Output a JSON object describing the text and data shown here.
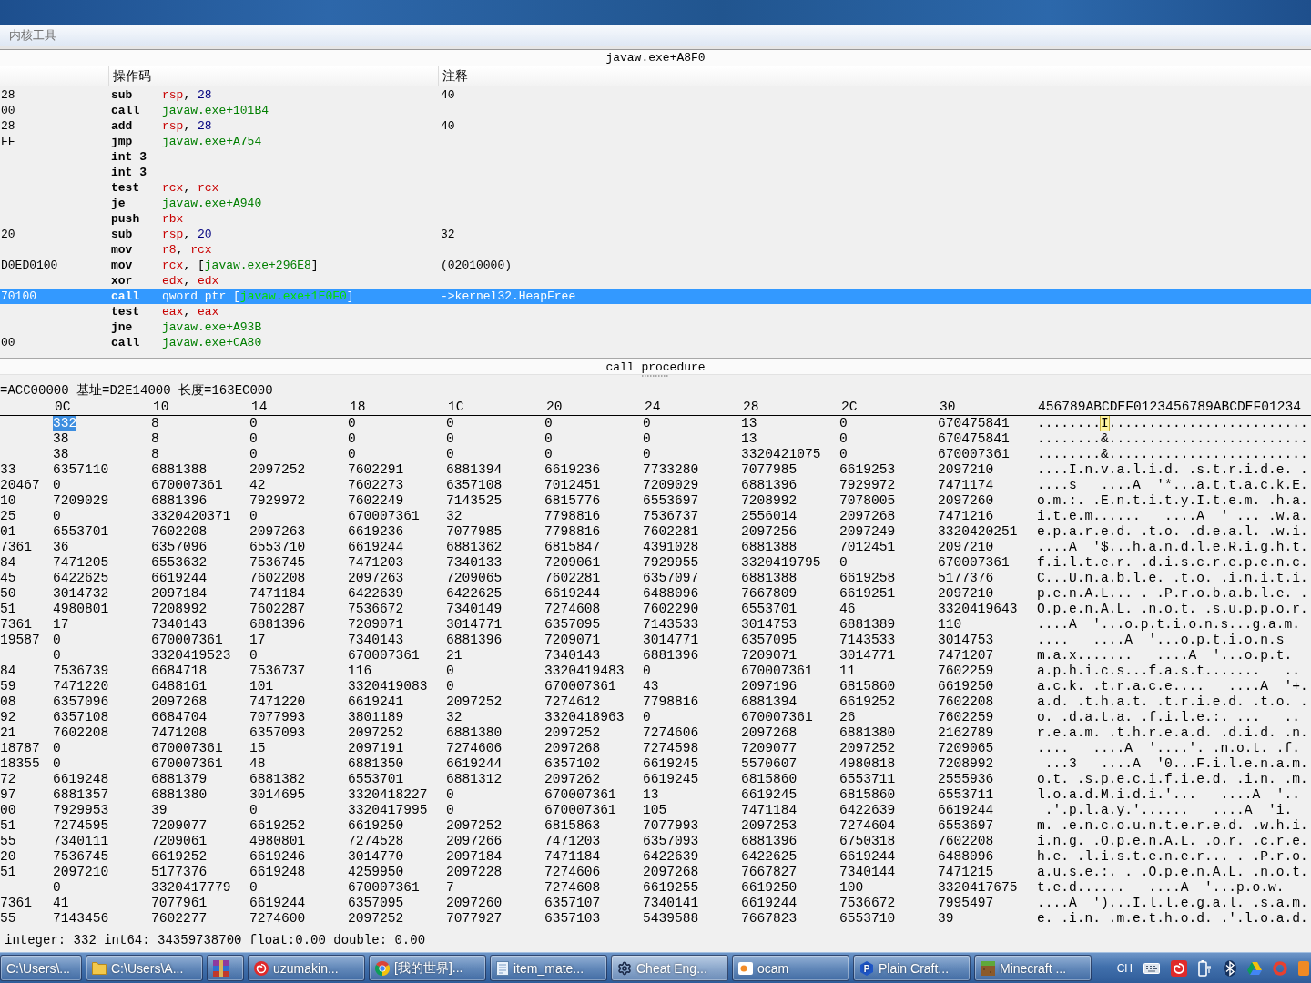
{
  "menu": [
    {
      "label": "内核工具"
    }
  ],
  "disassembly": {
    "address": "javaw.exe+A8F0",
    "columns": [
      "操作码",
      "注释"
    ],
    "rows": [
      {
        "bytes": "28",
        "mnemonic": "sub",
        "operands": [
          {
            "text": "rsp",
            "kind": "register"
          },
          {
            "text": ", ",
            "kind": "plain"
          },
          {
            "text": "28",
            "kind": "number"
          }
        ],
        "comment": "40",
        "selected": false
      },
      {
        "bytes": "00",
        "mnemonic": "call",
        "operands": [
          {
            "text": "javaw.exe+101B4",
            "kind": "symbol"
          }
        ],
        "selected": false
      },
      {
        "bytes": "28",
        "mnemonic": "add",
        "operands": [
          {
            "text": "rsp",
            "kind": "register"
          },
          {
            "text": ", ",
            "kind": "plain"
          },
          {
            "text": "28",
            "kind": "number"
          }
        ],
        "comment": "40",
        "selected": false
      },
      {
        "bytes": "FF",
        "mnemonic": "jmp",
        "operands": [
          {
            "text": "javaw.exe+A754",
            "kind": "symbol"
          }
        ],
        "selected": false
      },
      {
        "mnemonic": "int 3",
        "selected": false
      },
      {
        "mnemonic": "int 3",
        "selected": false
      },
      {
        "mnemonic": "test",
        "operands": [
          {
            "text": "rcx",
            "kind": "register"
          },
          {
            "text": ", ",
            "kind": "plain"
          },
          {
            "text": "rcx",
            "kind": "register"
          }
        ],
        "selected": false
      },
      {
        "mnemonic": "je",
        "operands": [
          {
            "text": "javaw.exe+A940",
            "kind": "symbol"
          }
        ],
        "selected": false
      },
      {
        "mnemonic": "push",
        "operands": [
          {
            "text": "rbx",
            "kind": "register"
          }
        ],
        "selected": false
      },
      {
        "bytes": "20",
        "mnemonic": "sub",
        "operands": [
          {
            "text": "rsp",
            "kind": "register"
          },
          {
            "text": ", ",
            "kind": "plain"
          },
          {
            "text": "20",
            "kind": "number"
          }
        ],
        "comment": "32",
        "selected": false
      },
      {
        "mnemonic": "mov",
        "operands": [
          {
            "text": "r8",
            "kind": "register"
          },
          {
            "text": ", ",
            "kind": "plain"
          },
          {
            "text": "rcx",
            "kind": "register"
          }
        ],
        "selected": false
      },
      {
        "bytes": "D0ED0100",
        "mnemonic": "mov",
        "operands": [
          {
            "text": "rcx",
            "kind": "register"
          },
          {
            "text": ", [",
            "kind": "plain"
          },
          {
            "text": "javaw.exe+296E8",
            "kind": "symbol"
          },
          {
            "text": "]",
            "kind": "plain"
          }
        ],
        "comment": "(02010000)",
        "selected": false
      },
      {
        "mnemonic": "xor",
        "operands": [
          {
            "text": "edx",
            "kind": "register"
          },
          {
            "text": ", ",
            "kind": "plain"
          },
          {
            "text": "edx",
            "kind": "register"
          }
        ],
        "selected": false
      },
      {
        "bytes": "70100",
        "mnemonic": "call",
        "operands": [
          {
            "text": "qword ptr [",
            "kind": "plain"
          },
          {
            "text": "javaw.exe+1E0F0",
            "kind": "symbol"
          },
          {
            "text": "]",
            "kind": "plain"
          }
        ],
        "comment": "->kernel32.HeapFree",
        "selected": true
      },
      {
        "mnemonic": "test",
        "operands": [
          {
            "text": "eax",
            "kind": "register"
          },
          {
            "text": ", ",
            "kind": "plain"
          },
          {
            "text": "eax",
            "kind": "register"
          }
        ],
        "selected": false
      },
      {
        "mnemonic": "jne",
        "operands": [
          {
            "text": "javaw.exe+A93B",
            "kind": "symbol"
          }
        ],
        "selected": false
      },
      {
        "bytes": "00",
        "mnemonic": "call",
        "operands": [
          {
            "text": "javaw.exe+CA80",
            "kind": "symbol"
          }
        ],
        "selected": false
      }
    ]
  },
  "procedure_label": "call procedure",
  "memory_view": {
    "region": "=ACC00000 基址=D2E14000 长度=163EC000",
    "columns": [
      "0C",
      "10",
      "14",
      "18",
      "1C",
      "20",
      "24",
      "28",
      "2C",
      "30"
    ],
    "ascii_header": "456789ABCDEF0123456789ABCDEF01234",
    "rows": [
      {
        "values": [
          "332",
          "8",
          "0",
          "0",
          "0",
          "0",
          "0",
          "13",
          "0",
          "670475841"
        ],
        "ascii": [
          {
            "text": "........",
            "cursor": false
          },
          {
            "text": "I",
            "cursor": true
          },
          {
            "text": ".........................",
            "cursor": false
          }
        ],
        "selected": true
      },
      {
        "values": [
          "38",
          "8",
          "0",
          "0",
          "0",
          "0",
          "0",
          "13",
          "0",
          "670475841"
        ],
        "ascii": [
          {
            "text": "........&.........................",
            "cursor": false
          }
        ],
        "selected": false
      },
      {
        "values": [
          "38",
          "8",
          "0",
          "0",
          "0",
          "0",
          "0",
          "3320421075",
          "0",
          "670007361"
        ],
        "ascii": [
          {
            "text": "........&.........................",
            "cursor": false
          }
        ],
        "selected": false
      },
      {
        "address": "33",
        "values": [
          "6357110",
          "6881388",
          "2097252",
          "7602291",
          "6881394",
          "6619236",
          "7733280",
          "7077985",
          "6619253",
          "2097210"
        ],
        "ascii": [
          {
            "text": "....I.n.v.a.l.i.d. .s.t.r.i.d.e. .",
            "cursor": false
          }
        ],
        "selected": false
      },
      {
        "address": "20467",
        "values": [
          "0",
          "670007361",
          "42",
          "7602273",
          "6357108",
          "7012451",
          "7209029",
          "6881396",
          "7929972",
          "7471174"
        ],
        "ascii": [
          {
            "text": "....s   ....A  '*...a.t.t.a.c.k.E.",
            "cursor": false
          }
        ],
        "selected": false
      },
      {
        "address": "10",
        "values": [
          "7209029",
          "6881396",
          "7929972",
          "7602249",
          "7143525",
          "6815776",
          "6553697",
          "7208992",
          "7078005",
          "2097260"
        ],
        "ascii": [
          {
            "text": "o.m.:. .E.n.t.i.t.y.I.t.e.m. .h.a.",
            "cursor": false
          }
        ],
        "selected": false
      },
      {
        "address": "25",
        "values": [
          "0",
          "3320420371",
          "0",
          "670007361",
          "32",
          "7798816",
          "7536737",
          "2556014",
          "2097268",
          "7471216"
        ],
        "ascii": [
          {
            "text": "i.t.e.m......   ....A  ' ... .w.a.",
            "cursor": false
          }
        ],
        "selected": false
      },
      {
        "address": "01",
        "values": [
          "6553701",
          "7602208",
          "2097263",
          "6619236",
          "7077985",
          "7798816",
          "7602281",
          "2097256",
          "2097249",
          "3320420251"
        ],
        "ascii": [
          {
            "text": "e.p.a.r.e.d. .t.o. .d.e.a.l. .w.i.",
            "cursor": false
          }
        ],
        "selected": false
      },
      {
        "address": "7361",
        "values": [
          "36",
          "6357096",
          "6553710",
          "6619244",
          "6881362",
          "6815847",
          "4391028",
          "6881388",
          "7012451",
          "2097210"
        ],
        "ascii": [
          {
            "text": "....A  '$...h.a.n.d.l.e.R.i.g.h.t.",
            "cursor": false
          }
        ],
        "selected": false
      },
      {
        "address": "84",
        "values": [
          "7471205",
          "6553632",
          "7536745",
          "7471203",
          "7340133",
          "7209061",
          "7929955",
          "3320419795",
          "0",
          "670007361"
        ],
        "ascii": [
          {
            "text": "f.i.l.t.e.r. .d.i.s.c.r.e.p.e.n.c.",
            "cursor": false
          }
        ],
        "selected": false
      },
      {
        "address": "45",
        "values": [
          "6422625",
          "6619244",
          "7602208",
          "2097263",
          "7209065",
          "7602281",
          "6357097",
          "6881388",
          "6619258",
          "5177376"
        ],
        "ascii": [
          {
            "text": "C...U.n.a.b.l.e. .t.o. .i.n.i.t.i.",
            "cursor": false
          }
        ],
        "selected": false
      },
      {
        "address": "50",
        "values": [
          "3014732",
          "2097184",
          "7471184",
          "6422639",
          "6422625",
          "6619244",
          "6488096",
          "7667809",
          "6619251",
          "2097210"
        ],
        "ascii": [
          {
            "text": "p.e.n.A.L... . .P.r.o.b.a.b.l.e. .",
            "cursor": false
          }
        ],
        "selected": false
      },
      {
        "address": "51",
        "values": [
          "4980801",
          "7208992",
          "7602287",
          "7536672",
          "7340149",
          "7274608",
          "7602290",
          "6553701",
          "46",
          "3320419643"
        ],
        "ascii": [
          {
            "text": "O.p.e.n.A.L. .n.o.t. .s.u.p.p.o.r.",
            "cursor": false
          }
        ],
        "selected": false
      },
      {
        "address": "7361",
        "values": [
          "17",
          "7340143",
          "6881396",
          "7209071",
          "3014771",
          "6357095",
          "7143533",
          "3014753",
          "6881389",
          "110"
        ],
        "ascii": [
          {
            "text": "....A  '...o.p.t.i.o.n.s...g.a.m.",
            "cursor": false
          }
        ],
        "selected": false
      },
      {
        "address": "19587",
        "values": [
          "0",
          "670007361",
          "17",
          "7340143",
          "6881396",
          "7209071",
          "3014771",
          "6357095",
          "7143533",
          "3014753"
        ],
        "ascii": [
          {
            "text": "....   ....A  '...o.p.t.i.o.n.s",
            "cursor": false
          }
        ],
        "selected": false
      },
      {
        "values": [
          "0",
          "3320419523",
          "0",
          "670007361",
          "21",
          "7340143",
          "6881396",
          "7209071",
          "3014771",
          "7471207"
        ],
        "ascii": [
          {
            "text": "m.a.x.......   ....A  '...o.p.t.",
            "cursor": false
          }
        ],
        "selected": false
      },
      {
        "address": "84",
        "values": [
          "7536739",
          "6684718",
          "7536737",
          "116",
          "0",
          "3320419483",
          "0",
          "670007361",
          "11",
          "7602259"
        ],
        "ascii": [
          {
            "text": "a.p.h.i.c.s...f.a.s.t.......   ..",
            "cursor": false
          }
        ],
        "selected": false
      },
      {
        "address": "59",
        "values": [
          "7471220",
          "6488161",
          "101",
          "3320419083",
          "0",
          "670007361",
          "43",
          "2097196",
          "6815860",
          "6619250"
        ],
        "ascii": [
          {
            "text": "a.c.k. .t.r.a.c.e....   ....A  '+.",
            "cursor": false
          }
        ],
        "selected": false
      },
      {
        "address": "08",
        "values": [
          "6357096",
          "2097268",
          "7471220",
          "6619241",
          "2097252",
          "7274612",
          "7798816",
          "6881394",
          "6619252",
          "7602208"
        ],
        "ascii": [
          {
            "text": "a.d. .t.h.a.t. .t.r.i.e.d. .t.o. .",
            "cursor": false
          }
        ],
        "selected": false
      },
      {
        "address": "92",
        "values": [
          "6357108",
          "6684704",
          "7077993",
          "3801189",
          "32",
          "3320418963",
          "0",
          "670007361",
          "26",
          "7602259"
        ],
        "ascii": [
          {
            "text": "o. .d.a.t.a. .f.i.l.e.:. ...   ..",
            "cursor": false
          }
        ],
        "selected": false
      },
      {
        "address": "21",
        "values": [
          "7602208",
          "7471208",
          "6357093",
          "2097252",
          "6881380",
          "2097252",
          "7274606",
          "2097268",
          "6881380",
          "2162789"
        ],
        "ascii": [
          {
            "text": "r.e.a.m. .t.h.r.e.a.d. .d.i.d. .n.",
            "cursor": false
          }
        ],
        "selected": false
      },
      {
        "address": "18787",
        "values": [
          "0",
          "670007361",
          "15",
          "2097191",
          "7274606",
          "2097268",
          "7274598",
          "7209077",
          "2097252",
          "7209065"
        ],
        "ascii": [
          {
            "text": "....   ....A  '....'. .n.o.t. .f.",
            "cursor": false
          }
        ],
        "selected": false
      },
      {
        "address": "18355",
        "values": [
          "0",
          "670007361",
          "48",
          "6881350",
          "6619244",
          "6357102",
          "6619245",
          "5570607",
          "4980818",
          "7208992"
        ],
        "ascii": [
          {
            "text": " ...3   ....A  '0...F.i.l.e.n.a.m.",
            "cursor": false
          }
        ],
        "selected": false
      },
      {
        "address": "72",
        "values": [
          "6619248",
          "6881379",
          "6881382",
          "6553701",
          "6881312",
          "2097262",
          "6619245",
          "6815860",
          "6553711",
          "2555936"
        ],
        "ascii": [
          {
            "text": "o.t. .s.p.e.c.i.f.i.e.d. .i.n. .m.",
            "cursor": false
          }
        ],
        "selected": false
      },
      {
        "address": "97",
        "values": [
          "6881357",
          "6881380",
          "3014695",
          "3320418227",
          "0",
          "670007361",
          "13",
          "6619245",
          "6815860",
          "6553711"
        ],
        "ascii": [
          {
            "text": "l.o.a.d.M.i.d.i.'...   ....A  '..",
            "cursor": false
          }
        ],
        "selected": false
      },
      {
        "address": "00",
        "values": [
          "7929953",
          "39",
          "0",
          "3320417995",
          "0",
          "670007361",
          "105",
          "7471184",
          "6422639",
          "6619244"
        ],
        "ascii": [
          {
            "text": " .'.p.l.a.y.'......   ....A  'i.",
            "cursor": false
          }
        ],
        "selected": false
      },
      {
        "address": "51",
        "values": [
          "7274595",
          "7209077",
          "6619252",
          "6619250",
          "2097252",
          "6815863",
          "7077993",
          "2097253",
          "7274604",
          "6553697"
        ],
        "ascii": [
          {
            "text": "m. .e.n.c.o.u.n.t.e.r.e.d. .w.h.i.",
            "cursor": false
          }
        ],
        "selected": false
      },
      {
        "address": "55",
        "values": [
          "7340111",
          "7209061",
          "4980801",
          "7274528",
          "2097266",
          "7471203",
          "6357093",
          "6881396",
          "6750318",
          "7602208"
        ],
        "ascii": [
          {
            "text": "i.n.g. .O.p.e.n.A.L. .o.r. .c.r.e.",
            "cursor": false
          }
        ],
        "selected": false
      },
      {
        "address": "20",
        "values": [
          "7536745",
          "6619252",
          "6619246",
          "3014770",
          "2097184",
          "7471184",
          "6422639",
          "6422625",
          "6619244",
          "6488096"
        ],
        "ascii": [
          {
            "text": "h.e. .l.i.s.t.e.n.e.r... . .P.r.o.",
            "cursor": false
          }
        ],
        "selected": false
      },
      {
        "address": "51",
        "values": [
          "2097210",
          "5177376",
          "6619248",
          "4259950",
          "2097228",
          "7274606",
          "2097268",
          "7667827",
          "7340144",
          "7471215"
        ],
        "ascii": [
          {
            "text": "a.u.s.e.:. . .O.p.e.n.A.L. .n.o.t.",
            "cursor": false
          }
        ],
        "selected": false
      },
      {
        "values": [
          "0",
          "3320417779",
          "0",
          "670007361",
          "7",
          "7274608",
          "6619255",
          "6619250",
          "100",
          "3320417675"
        ],
        "ascii": [
          {
            "text": "t.e.d......   ....A  '...p.o.w.",
            "cursor": false
          }
        ],
        "selected": false
      },
      {
        "address": "7361",
        "values": [
          "41",
          "7077961",
          "6619244",
          "6357095",
          "2097260",
          "6357107",
          "7340141",
          "6619244",
          "7536672",
          "7995497"
        ],
        "ascii": [
          {
            "text": "....A  ')...I.l.l.e.g.a.l. .s.a.m.",
            "cursor": false
          }
        ],
        "selected": false
      },
      {
        "address": "55",
        "values": [
          "7143456",
          "7602277",
          "7274600",
          "2097252",
          "7077927",
          "6357103",
          "5439588",
          "7667823",
          "6553710",
          "39"
        ],
        "ascii": [
          {
            "text": "e. .i.n. .m.e.t.h.o.d. .'.l.o.a.d.",
            "cursor": false
          }
        ],
        "selected": false
      }
    ]
  },
  "status_bar": "integer: 332 int64: 34359738700 float:0.00 double: 0.00",
  "taskbar": {
    "items": [
      {
        "label": "C:\\Users\\...",
        "kind": "none",
        "selected": false
      },
      {
        "label": "C:\\Users\\A...",
        "kind": "folder",
        "selected": false
      },
      {
        "kind": "books",
        "selected": false
      },
      {
        "label": "uzumakin...",
        "kind": "spiral",
        "selected": false
      },
      {
        "label": "[我的世界]...",
        "kind": "segmented",
        "selected": false
      },
      {
        "label": "item_mate...",
        "kind": "document",
        "selected": false
      },
      {
        "label": "Cheat Eng...",
        "kind": "gear",
        "selected": true
      },
      {
        "label": "ocam",
        "kind": "record",
        "selected": false
      },
      {
        "label": "Plain Craft...",
        "kind": "hexagon",
        "badge": "P",
        "selected": false
      },
      {
        "label": "Minecraft ...",
        "kind": "block",
        "selected": false
      }
    ],
    "tray": {
      "language": "CH",
      "icons": [
        {
          "kind": "keyboard"
        },
        {
          "kind": "spiral-tile"
        },
        {
          "kind": "device"
        },
        {
          "kind": "bluetooth"
        },
        {
          "kind": "triangle"
        },
        {
          "kind": "ring"
        },
        {
          "kind": "app"
        }
      ]
    }
  }
}
